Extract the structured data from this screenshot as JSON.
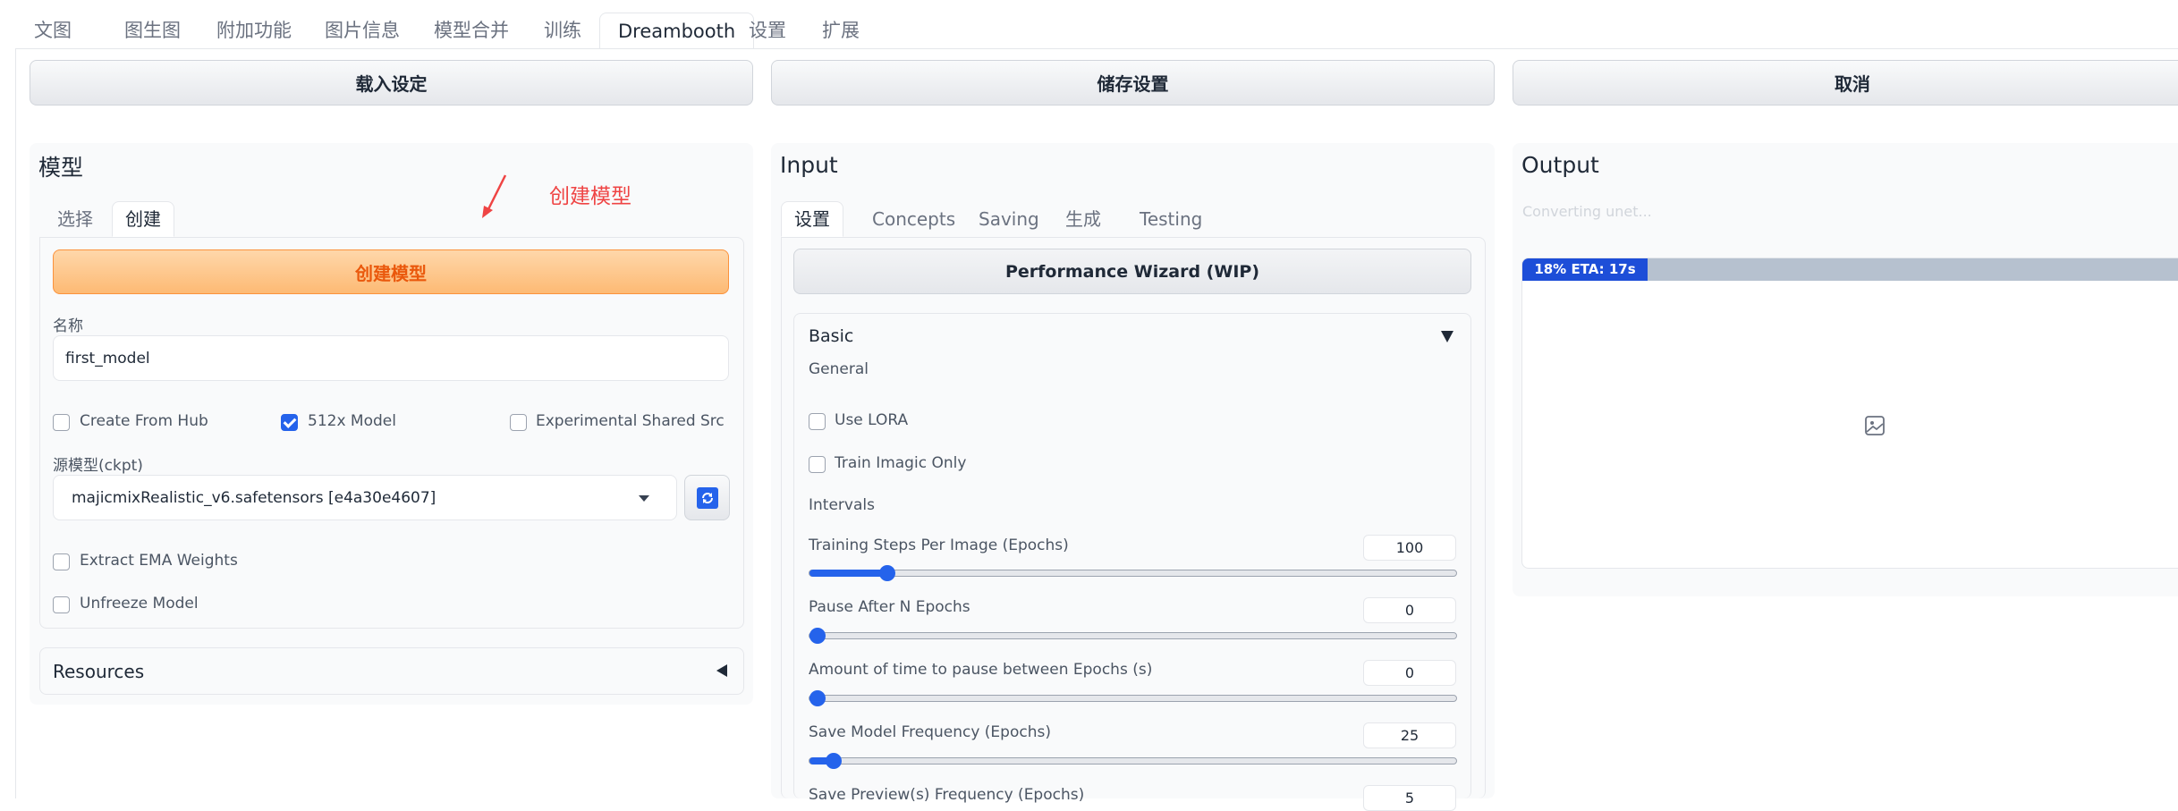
{
  "tabs": [
    {
      "label": "文图",
      "active": false
    },
    {
      "label": "图生图",
      "active": false
    },
    {
      "label": "附加功能",
      "active": false
    },
    {
      "label": "图片信息",
      "active": false
    },
    {
      "label": "模型合并",
      "active": false
    },
    {
      "label": "训练",
      "active": false
    },
    {
      "label": "Dreambooth",
      "active": true
    },
    {
      "label": "设置",
      "active": false
    },
    {
      "label": "扩展",
      "active": false
    }
  ],
  "toolbar": {
    "load_label": "载入设定",
    "save_label": "储存设置",
    "cancel_label": "取消"
  },
  "model_panel": {
    "title": "模型",
    "tabs": [
      "选择",
      "创建"
    ],
    "annotation": "创建模型",
    "create_button": "创建模型",
    "name_label": "名称",
    "name_value": "first_model",
    "create_from_hub": {
      "label": "Create From Hub",
      "checked": false
    },
    "model_512x": {
      "label": "512x Model",
      "checked": true
    },
    "experimental_shared_src": {
      "label": "Experimental Shared Src",
      "checked": false
    },
    "source_label": "源模型(ckpt)",
    "source_value": "majicmixRealistic_v6.safetensors [e4a30e4607]",
    "extract_ema": {
      "label": "Extract EMA Weights",
      "checked": false
    },
    "unfreeze_model": {
      "label": "Unfreeze Model",
      "checked": false
    },
    "resources_label": "Resources"
  },
  "input_panel": {
    "title": "Input",
    "tabs": [
      "设置",
      "Concepts",
      "Saving",
      "生成",
      "Testing"
    ],
    "wizard_button": "Performance Wizard (WIP)",
    "basic_label": "Basic",
    "general_label": "General",
    "use_lora": {
      "label": "Use LORA",
      "checked": false
    },
    "train_imagic_only": {
      "label": "Train Imagic Only",
      "checked": false
    },
    "intervals_label": "Intervals",
    "sliders": [
      {
        "label": "Training Steps Per Image (Epochs)",
        "value": "100",
        "fraction": 0.11
      },
      {
        "label": "Pause After N Epochs",
        "value": "0",
        "fraction": 0.0
      },
      {
        "label": "Amount of time to pause between Epochs (s)",
        "value": "0",
        "fraction": 0.0
      },
      {
        "label": "Save Model Frequency (Epochs)",
        "value": "25",
        "fraction": 0.025
      },
      {
        "label": "Save Preview(s) Frequency (Epochs)",
        "value": "5",
        "fraction": 0.0
      }
    ]
  },
  "output_panel": {
    "title": "Output",
    "status_text": "Converting unet...",
    "progress_text": "18% ETA: 17s",
    "progress": 0.18
  },
  "colors": {
    "accent": "#2563eb",
    "primary_button": "#fdba74",
    "primary_text": "#ea580c",
    "annotation": "#ef4444"
  }
}
